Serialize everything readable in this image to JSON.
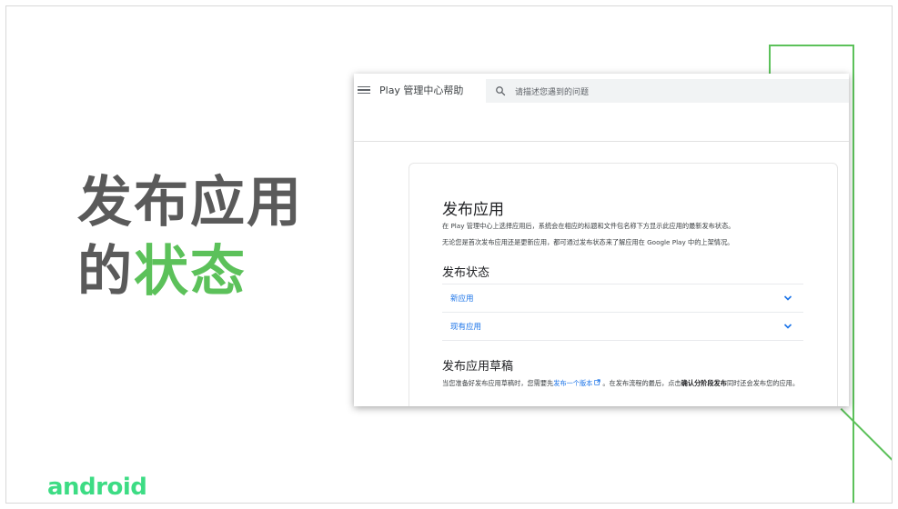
{
  "slide": {
    "title_line1": "发布应用",
    "title_line2_plain": "的",
    "title_line2_accent": "状态",
    "logo_text": "android",
    "colors": {
      "accent": "#5cc15a",
      "logo": "#3ddc84",
      "title": "#5a5a5a",
      "link": "#1a73e8"
    }
  },
  "help_page": {
    "app_title": "Play 管理中心帮助",
    "search_placeholder": "请描述您遇到的问题",
    "heading": "发布应用",
    "intro_1": "在 Play 管理中心上选择应用后，系统会在相应的标题和文件包名称下方显示此应用的最新发布状态。",
    "intro_2": "无论您是首次发布应用还是更新应用，都可通过发布状态来了解应用在 Google Play 中的上架情况。",
    "status_heading": "发布状态",
    "accordions": [
      {
        "label": "新应用"
      },
      {
        "label": "现有应用"
      }
    ],
    "drafts_heading": "发布应用草稿",
    "drafts_text_a": "当您准备好发布应用草稿时，您需要先",
    "drafts_link": "发布一个版本",
    "drafts_text_b": "。在发布流程的最后，点击",
    "drafts_strong": "确认分阶段发布",
    "drafts_text_c": "同时还会发布您的应用。"
  },
  "icons": [
    "menu-icon",
    "search-icon",
    "chevron-down-icon",
    "external-link-icon"
  ]
}
